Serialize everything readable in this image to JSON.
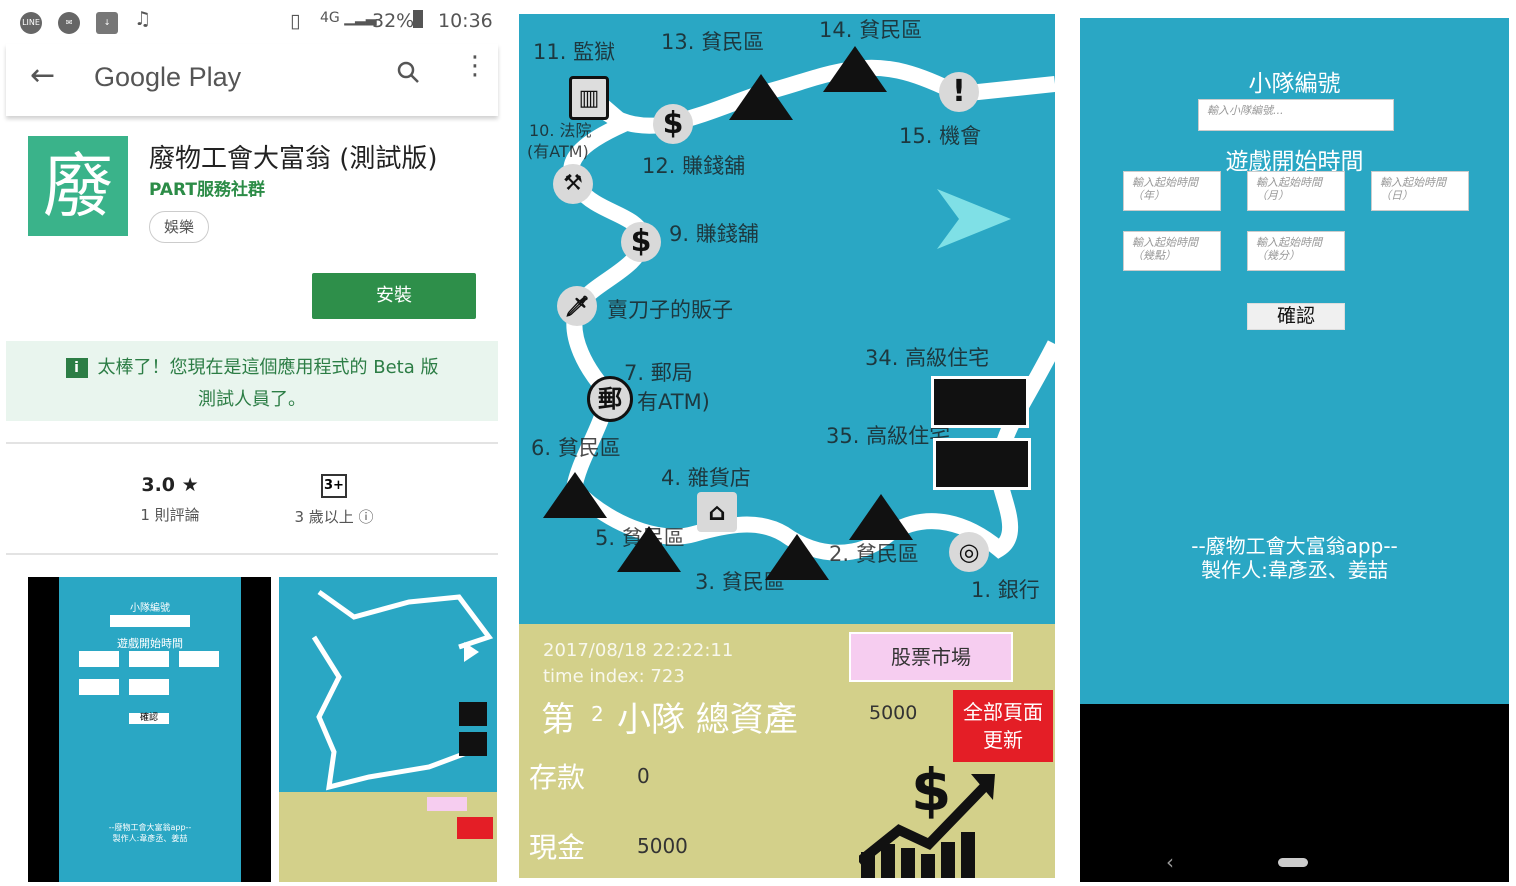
{
  "play": {
    "status": {
      "battery": "32%",
      "time": "10:36"
    },
    "appbar_title": "Google Play",
    "app": {
      "icon_char": "廢",
      "name": "廢物工會大富翁 (測試版)",
      "developer": "PART服務社群",
      "category": "娛樂"
    },
    "install_label": "安裝",
    "beta_line1": "太棒了！您現在是這個應用程式的 Beta 版",
    "beta_line2": "測試人員了。",
    "rating_value": "3.0 ★",
    "rating_count": "1 則評論",
    "age_badge": "3+",
    "age_label": "3 歲以上 ⓘ",
    "thumb_a": {
      "team": "小隊編號",
      "time": "遊戲開始時間",
      "confirm": "確認",
      "credit1": "--廢物工會大富翁app--",
      "credit2": "製作人:韋彥丞、姜喆"
    }
  },
  "board": {
    "squares": [
      {
        "id": "s11",
        "label": "11. 監獄"
      },
      {
        "id": "s13",
        "label": "13. 貧民區"
      },
      {
        "id": "s14",
        "label": "14. 貧民區"
      },
      {
        "id": "s10",
        "label": "10. 法院"
      },
      {
        "id": "s10b",
        "label": "(有ATM)"
      },
      {
        "id": "s12",
        "label": "12. 賺錢舖"
      },
      {
        "id": "s15",
        "label": "15. 機會"
      },
      {
        "id": "s9",
        "label": "9. 賺錢舖"
      },
      {
        "id": "s8",
        "label": "賣刀子的販子"
      },
      {
        "id": "s7",
        "label": "7. 郵局"
      },
      {
        "id": "s7b",
        "label": "有ATM)"
      },
      {
        "id": "s34",
        "label": "34. 高級住宅"
      },
      {
        "id": "s35",
        "label": "35. 高級住宅"
      },
      {
        "id": "s6",
        "label": "6. 貧民區"
      },
      {
        "id": "s4",
        "label": "4. 雜貨店"
      },
      {
        "id": "s5",
        "label": "5. 貧民區"
      },
      {
        "id": "s3",
        "label": "3. 貧民區"
      },
      {
        "id": "s2",
        "label": "2. 貧民區"
      },
      {
        "id": "s1",
        "label": "1. 銀行"
      }
    ],
    "datetime": "2017/08/18 22:22:11",
    "time_index": "time index: 723",
    "team_prefix": "第",
    "team_number": "2",
    "team_suffix": "小隊  總資產",
    "total_assets": "5000",
    "deposit_label": "存款",
    "deposit_value": "0",
    "cash_label": "現金",
    "cash_value": "5000",
    "stock_button": "股票市場",
    "refresh_line1": "全部頁面",
    "refresh_line2": "更新"
  },
  "setup": {
    "team_title": "小隊編號",
    "team_placeholder": "輸入小隊編號...",
    "time_title": "遊戲開始時間",
    "year_placeholder": "輸入起始時間（年）",
    "month_placeholder": "輸入起始時間（月）",
    "day_placeholder": "輸入起始時間（日）",
    "hour_placeholder": "輸入起始時間（幾點）",
    "minute_placeholder": "輸入起始時間（幾分）",
    "confirm": "確認",
    "credit_line1": "--廢物工會大富翁app--",
    "credit_line2": "製作人:韋彥丞、姜喆"
  },
  "colors": {
    "accent_green": "#2e8f4a",
    "board_blue": "#2aa7c4",
    "panel_khaki": "#d3d08a",
    "refresh_red": "#e41e26"
  },
  "icons": [
    "line-icon",
    "messenger-icon",
    "download-icon",
    "music-icon",
    "vibrate-icon",
    "signal-icon",
    "battery-icon",
    "back-icon",
    "search-icon",
    "more-icon",
    "info-icon",
    "star-icon",
    "arrow-icon",
    "dollar-icon",
    "chance-icon",
    "bank-icon",
    "house-icon",
    "tent-icon"
  ]
}
